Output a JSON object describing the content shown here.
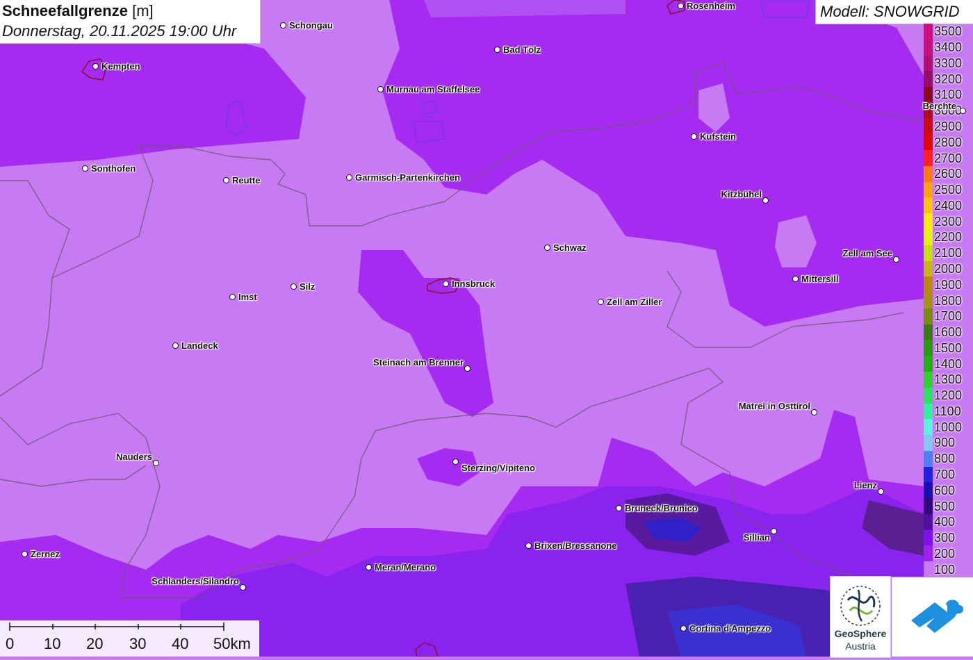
{
  "title": {
    "main": "Schneefallgrenze",
    "unit": "[m]",
    "datetime": "Donnerstag, 20.11.2025 19:00 Uhr"
  },
  "model": "Modell: SNOWGRID",
  "legend": {
    "labels": [
      "3500",
      "3400",
      "3300",
      "3200",
      "3100",
      "3000",
      "2900",
      "2800",
      "2700",
      "2600",
      "2500",
      "2400",
      "2300",
      "2200",
      "2100",
      "2000",
      "1900",
      "1800",
      "1700",
      "1600",
      "1500",
      "1400",
      "1300",
      "1200",
      "1100",
      "1000",
      "900",
      "800",
      "700",
      "600",
      "500",
      "400",
      "300",
      "200",
      "100"
    ],
    "colors": [
      "#d0107a",
      "#c8107c",
      "#b50f75",
      "#9a0d67",
      "#8a0a1a",
      "#b0091a",
      "#cc0a10",
      "#e30808",
      "#ff2020",
      "#ff7a10",
      "#ffa010",
      "#ffc010",
      "#ffe810",
      "#e4f010",
      "#c0e010",
      "#c8b410",
      "#b88a10",
      "#a89010",
      "#7a8a10",
      "#3a7a10",
      "#2a9a10",
      "#20b010",
      "#30d030",
      "#30e060",
      "#30f0a0",
      "#60f0e0",
      "#80c8f0",
      "#5080f0",
      "#2020e0",
      "#1a10b0",
      "#30087a",
      "#5010a0",
      "#8010f0",
      "#a020f0",
      "#c87af5"
    ]
  },
  "cities": [
    {
      "name": "Rosenheim"
    },
    {
      "name": "Schongau"
    },
    {
      "name": "Bad Tölz"
    },
    {
      "name": "Kempten"
    },
    {
      "name": "Murnau am Staffelsee"
    },
    {
      "name": "Berchte"
    },
    {
      "name": "Kufstein"
    },
    {
      "name": "Sonthofen"
    },
    {
      "name": "Reutte"
    },
    {
      "name": "Garmisch-Partenkirchen"
    },
    {
      "name": "Kitzbühel"
    },
    {
      "name": "Schwaz"
    },
    {
      "name": "Zell am See"
    },
    {
      "name": "Mittersill"
    },
    {
      "name": "Innsbruck"
    },
    {
      "name": "Silz"
    },
    {
      "name": "Imst"
    },
    {
      "name": "Zell am Ziller"
    },
    {
      "name": "Landeck"
    },
    {
      "name": "Steinach am Brenner"
    },
    {
      "name": "Matrei in Osttirol"
    },
    {
      "name": "Nauders"
    },
    {
      "name": "Sterzing/Vipiteno"
    },
    {
      "name": "Lienz"
    },
    {
      "name": "Bruneck/Brunico"
    },
    {
      "name": "Sillian"
    },
    {
      "name": "Brixen/Bressanone"
    },
    {
      "name": "Zernez"
    },
    {
      "name": "Meran/Merano"
    },
    {
      "name": "Schlanders/Silandro"
    },
    {
      "name": "Cortina d'Ampezzo"
    }
  ],
  "scale": {
    "labels": [
      "0",
      "10",
      "20",
      "30",
      "40",
      "50km"
    ]
  },
  "logos": {
    "geosphere_line1": "GeoSphere",
    "geosphere_line2": "Austria"
  }
}
